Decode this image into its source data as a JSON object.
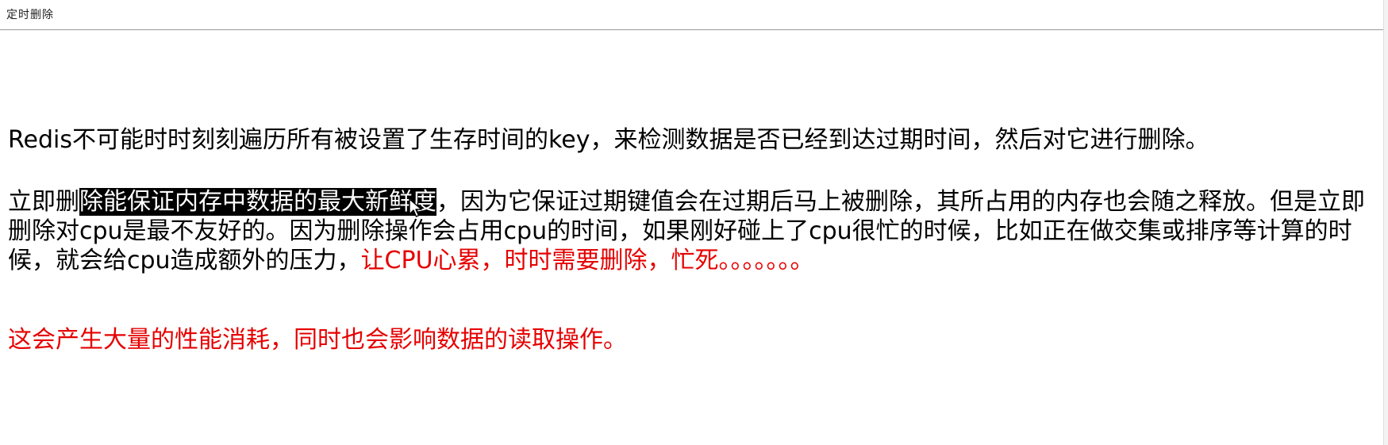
{
  "header": {
    "title": "定时删除"
  },
  "paragraphs": {
    "p1": "Redis不可能时时刻刻遍历所有被设置了生存时间的key，来检测数据是否已经到达过期时间，然后对它进行删除。",
    "p2": {
      "before": "立即删",
      "highlighted": "除能保证内存中数据的最大新鲜度",
      "after": "，因为它保证过期键值会在过期后马上被删除，其所占用的内存也会随之释放。但是立即删除对cpu是最不友好的。因为删除操作会占用cpu的时间，如果刚好碰上了cpu很忙的时候，比如正在做交集或排序等计算的时候，就会给cpu造成额外的压力，",
      "red": "让CPU心累，时时需要删除，忙死。。。。。。。"
    },
    "p3": "这会产生大量的性能消耗，同时也会影响数据的读取操作。"
  },
  "colors": {
    "text": "#000000",
    "emphasis_red": "#e60000",
    "selection_bg": "#000000",
    "selection_text": "#ffffff"
  },
  "icons": {
    "cursor": "mouse-pointer-icon"
  }
}
